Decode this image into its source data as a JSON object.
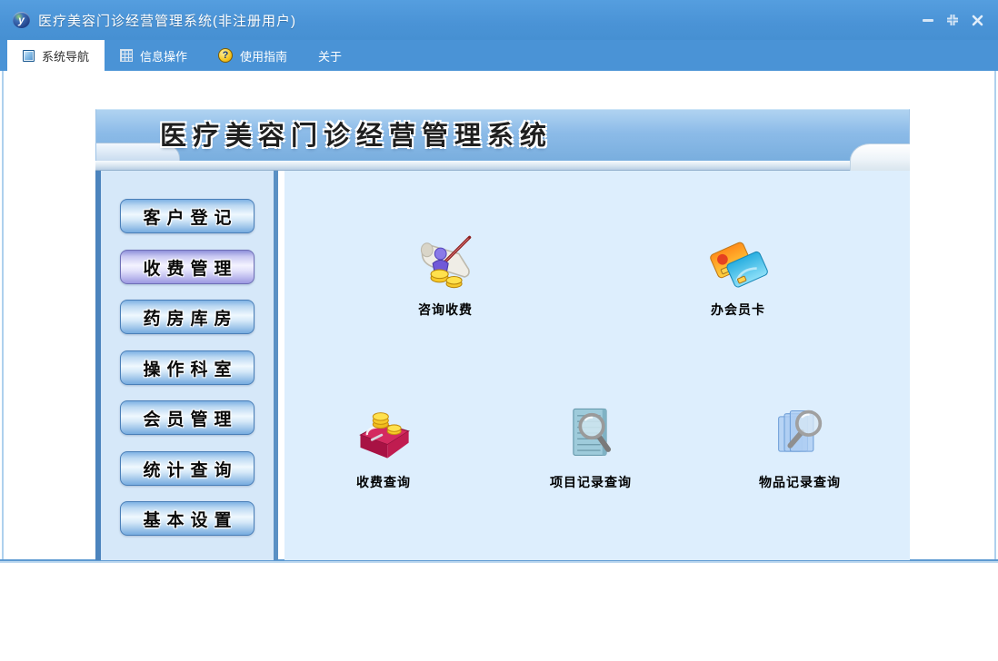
{
  "window": {
    "title": "医疗美容门诊经营管理系统(非注册用户)",
    "app_icon_letter": "y"
  },
  "tabs": [
    {
      "label": "系统导航",
      "icon": "navigation-square-icon",
      "active": true
    },
    {
      "label": "信息操作",
      "icon": "grid-icon",
      "active": false
    },
    {
      "label": "使用指南",
      "icon": "help-icon",
      "active": false
    },
    {
      "label": "关于",
      "icon": null,
      "active": false
    }
  ],
  "banner": {
    "title": "医疗美容门诊经营管理系统"
  },
  "sidebar": {
    "items": [
      {
        "label": "客户登记",
        "selected": false
      },
      {
        "label": "收费管理",
        "selected": true
      },
      {
        "label": "药房库房",
        "selected": false
      },
      {
        "label": "操作科室",
        "selected": false
      },
      {
        "label": "会员管理",
        "selected": false
      },
      {
        "label": "统计查询",
        "selected": false
      },
      {
        "label": "基本设置",
        "selected": false
      }
    ]
  },
  "main": {
    "shortcuts": [
      {
        "label": "咨询收费",
        "icon": "consult-fee-icon"
      },
      {
        "label": "办会员卡",
        "icon": "member-card-icon"
      },
      {
        "label": "收费查询",
        "icon": "fee-query-icon"
      },
      {
        "label": "项目记录查询",
        "icon": "project-record-query-icon"
      },
      {
        "label": "物品记录查询",
        "icon": "item-record-query-icon"
      }
    ]
  },
  "help_icon_glyph": "?",
  "colors": {
    "titlebar_blue": "#4a93d6",
    "banner_band_blue": "#8cbbe8",
    "sidebar_bg": "#d6e8f9",
    "main_bg": "#ddeefd",
    "button_blue": "#7fb2e4",
    "selected_button_lavender": "#9d9ae2",
    "sidebar_border_blue": "#4c84bd"
  }
}
